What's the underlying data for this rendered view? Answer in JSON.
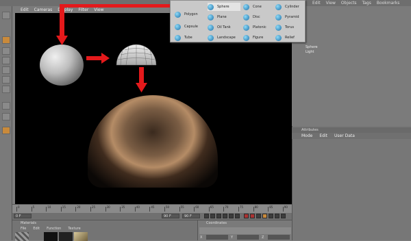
{
  "viewport_menu": [
    "Edit",
    "Cameras",
    "Display",
    "Filter",
    "View"
  ],
  "object_manager_menu": [
    "Edit",
    "View",
    "Objects",
    "Tags",
    "Bookmarks"
  ],
  "objects": [
    "Sphere",
    "Light"
  ],
  "attributes": {
    "title": "Attributes",
    "menu": [
      "Mode",
      "Edit",
      "User Data"
    ]
  },
  "primitives_popup": {
    "col1": [
      "Sphere",
      "Plane",
      "Oil Tank",
      "Landscape"
    ],
    "col0": [
      "Polygon",
      "Capsule",
      "Tube"
    ],
    "col2": [
      "Cone",
      "Disc",
      "Platonic",
      "Figure"
    ],
    "col3": [
      "Cylinder",
      "Pyramid",
      "Torus",
      "Relief"
    ],
    "highlighted": "Sphere"
  },
  "timeline": {
    "frame_start": "0 F",
    "frame_current": "90 F",
    "frame_end": "90 F",
    "ticks": [
      "0",
      "5",
      "10",
      "15",
      "20",
      "25",
      "30",
      "35",
      "40",
      "45",
      "50",
      "55",
      "60",
      "65",
      "70",
      "75",
      "80",
      "85",
      "90"
    ]
  },
  "material_manager": {
    "title": "Materials",
    "menu": [
      "File",
      "Edit",
      "Function",
      "Texture"
    ]
  },
  "coordinates": {
    "title": "Coordinates",
    "axes": [
      "X",
      "Y",
      "Z"
    ]
  },
  "colors": {
    "arrow": "#e4191b",
    "viewport_bg": "#000000",
    "accent": "#1b6fa8"
  }
}
